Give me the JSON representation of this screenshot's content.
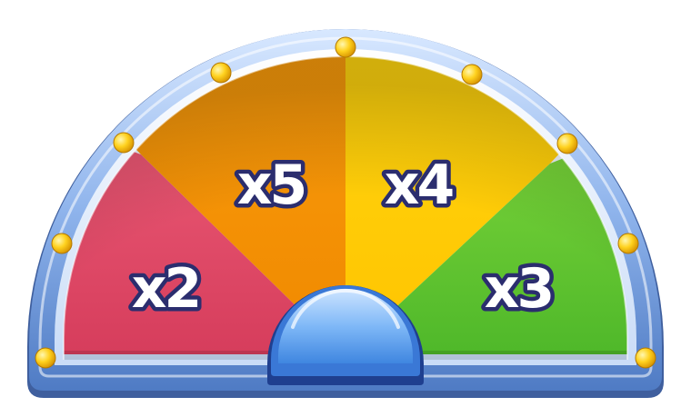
{
  "wheel": {
    "segments": [
      {
        "label": "x2",
        "color": "#e64d6a"
      },
      {
        "label": "x5",
        "color": "#ff9d05"
      },
      {
        "label": "x4",
        "color": "#ffd40a"
      },
      {
        "label": "x3",
        "color": "#6ccd35"
      }
    ],
    "frame_color": "#8fb4ec",
    "hub_color": "#5aa4f2",
    "label_outline": "#2b2d6e"
  }
}
